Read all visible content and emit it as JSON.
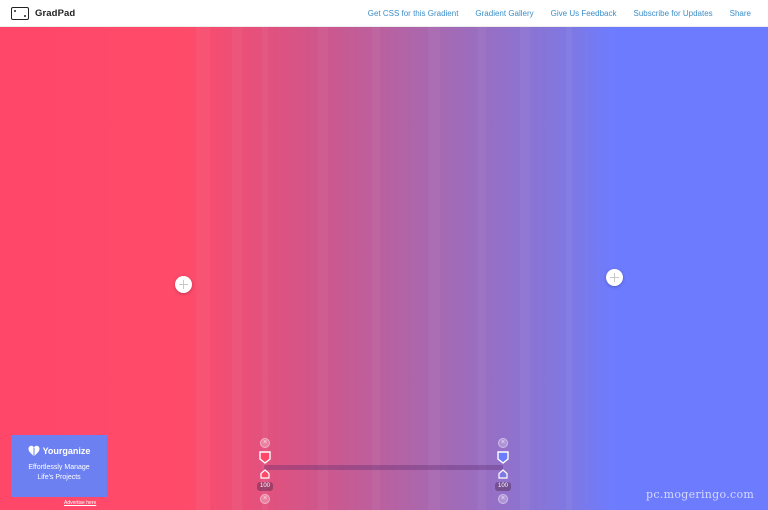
{
  "app": {
    "title": "GradPad"
  },
  "nav": [
    {
      "label": "Get CSS for this Gradient"
    },
    {
      "label": "Gradient Gallery"
    },
    {
      "label": "Give Us Feedback"
    },
    {
      "label": "Subscribe for Updates"
    },
    {
      "label": "Share"
    }
  ],
  "gradient": {
    "start_color": "#ff4769",
    "end_color": "#6d7cff",
    "stops": [
      {
        "color": "#ff4769",
        "opacity": "100"
      },
      {
        "color": "#6d7cff",
        "opacity": "100"
      }
    ]
  },
  "ad": {
    "brand": "Yourganize",
    "tagline_line1": "Effortlessly Manage",
    "tagline_line2": "Life's Projects",
    "link": "Advertise here"
  },
  "watermark": "pc.mogeringo.com"
}
